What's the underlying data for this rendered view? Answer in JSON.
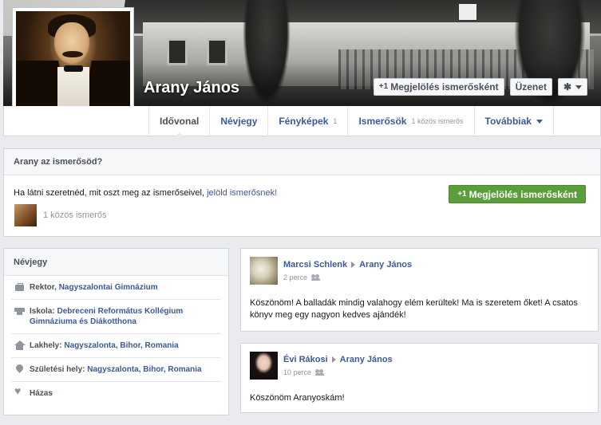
{
  "profile": {
    "name": "Arany János"
  },
  "cover_buttons": {
    "add_friend": "Megjelölés ismerősként",
    "message": "Üzenet"
  },
  "tabs": [
    {
      "label": "Idővonal",
      "sub": ""
    },
    {
      "label": "Névjegy",
      "sub": ""
    },
    {
      "label": "Fényképek",
      "sub": "1"
    },
    {
      "label": "Ismerősök",
      "sub": "1 közös ismerős"
    },
    {
      "label": "Továbbiak",
      "sub": ""
    }
  ],
  "friend_prompt": {
    "heading": "Arany az ismerősöd?",
    "text_before": "Ha látni szeretnéd, mit oszt meg az ismerőseivel, ",
    "text_link": "jelöld ismerősnek!",
    "button": "Megjelölés ismerősként",
    "mutual": "1 közös ismerős"
  },
  "about": {
    "heading": "Névjegy",
    "items": [
      {
        "icon": "briefcase-icon",
        "label": "Rektor, ",
        "value": "Nagyszalontai Gimnázium"
      },
      {
        "icon": "school-icon",
        "label": "Iskola: ",
        "value": "Debreceni Református Kollégium Gimnáziuma és Diákotthona"
      },
      {
        "icon": "home-icon",
        "label": "Lakhely: ",
        "value": "Nagyszalonta, Bihor, Romania"
      },
      {
        "icon": "location-pin-icon",
        "label": "Születési hely: ",
        "value": "Nagyszalonta, Bihor, Romania"
      },
      {
        "icon": "heart-icon",
        "label": "Házas",
        "value": ""
      }
    ]
  },
  "posts": [
    {
      "author": "Marcsi Schlenk",
      "target": "Arany János",
      "time": "2 perce",
      "text": "Köszönöm! A balladák mindig valahogy elém kerültek! Ma is szeretem őket! A csatos könyv meg egy nagyon kedves ajándék!"
    },
    {
      "author": "Évi Rákosi",
      "target": "Arany János",
      "time": "10 perce",
      "text": "Köszönöm Aranyoskám!"
    }
  ]
}
